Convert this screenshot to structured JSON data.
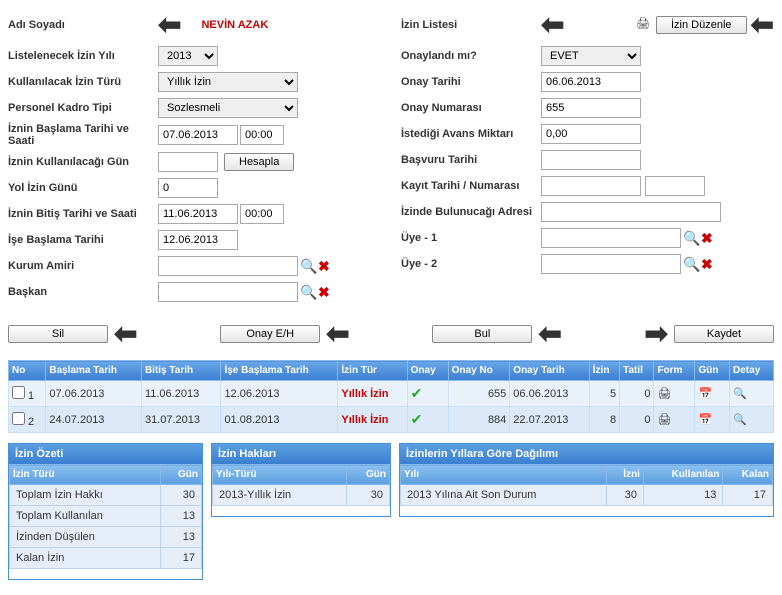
{
  "left": {
    "name_label": "Adı Soyadı",
    "name_value": "NEVİN AZAK",
    "year_label": "Listelenecek İzin Yılı",
    "year_value": "2013",
    "type_label": "Kullanılacak İzin Türü",
    "type_value": "Yıllık İzin",
    "kadro_label": "Personel Kadro Tipi",
    "kadro_value": "Sozlesmeli",
    "start_label": "İznin Başlama Tarihi ve Saati",
    "start_date": "07.06.2013",
    "start_time": "00:00",
    "days_label": "İznin Kullanılacağı Gün",
    "calc_btn": "Hesapla",
    "road_label": "Yol İzin Günü",
    "road_value": "0",
    "end_label": "İznin Bitiş Tarihi ve Saati",
    "end_date": "11.06.2013",
    "end_time": "00:00",
    "work_label": "İşe Başlama Tarihi",
    "work_date": "12.06.2013",
    "amir_label": "Kurum Amiri",
    "baskan_label": "Başkan"
  },
  "right": {
    "list_label": "İzin Listesi",
    "edit_btn": "İzin Düzenle",
    "approved_label": "Onaylandı mı?",
    "approved_value": "EVET",
    "approve_date_label": "Onay Tarihi",
    "approve_date": "06.06.2013",
    "approve_no_label": "Onay Numarası",
    "approve_no": "655",
    "avans_label": "İstediği Avans Miktarı",
    "avans_value": "0,00",
    "basvuru_label": "Başvuru Tarihi",
    "kayit_label": "Kayıt Tarihi / Numarası",
    "adres_label": "İzinde Bulunucağı Adresi",
    "uye1_label": "Üye - 1",
    "uye2_label": "Üye - 2"
  },
  "buttons": {
    "sil": "Sil",
    "onay": "Onay E/H",
    "bul": "Bul",
    "kaydet": "Kaydet"
  },
  "grid": {
    "headers": {
      "no": "No",
      "start": "Başlama Tarih",
      "end": "Bitiş Tarih",
      "work": "İşe Başlama Tarih",
      "type": "İzin Tür",
      "onay": "Onay",
      "onayno": "Onay No",
      "onaytarih": "Onay Tarih",
      "izin": "İzin",
      "tatil": "Tatil",
      "form": "Form",
      "gun": "Gün",
      "detay": "Detay"
    },
    "rows": [
      {
        "no": "1",
        "start": "07.06.2013",
        "end": "11.06.2013",
        "work": "12.06.2013",
        "type": "Yıllık İzin",
        "onay": "✔",
        "onayno": "655",
        "onaytarih": "06.06.2013",
        "izin": "5",
        "tatil": "0"
      },
      {
        "no": "2",
        "start": "24.07.2013",
        "end": "31.07.2013",
        "work": "01.08.2013",
        "type": "Yıllık İzin",
        "onay": "✔",
        "onayno": "884",
        "onaytarih": "22.07.2013",
        "izin": "8",
        "tatil": "0"
      }
    ]
  },
  "panels": {
    "ozet_title": "İzin Özeti",
    "ozet_h1": "İzin Türü",
    "ozet_h2": "Gün",
    "ozet_rows": [
      {
        "k": "Toplam İzin Hakkı",
        "v": "30"
      },
      {
        "k": "Toplam Kullanılan",
        "v": "13"
      },
      {
        "k": "İzinden Düşülen",
        "v": "13"
      },
      {
        "k": "Kalan İzin",
        "v": "17"
      }
    ],
    "haklar_title": "İzin Hakları",
    "haklar_h1": "Yılı-Türü",
    "haklar_h2": "Gün",
    "haklar_rows": [
      {
        "k": "2013-Yıllık İzin",
        "v": "30"
      }
    ],
    "dagilim_title": "İzinlerin Yıllara Göre Dağılımı",
    "dag_h1": "Yılı",
    "dag_h2": "İzni",
    "dag_h3": "Kullanılan",
    "dag_h4": "Kalan",
    "dag_rows": [
      {
        "y": "2013 Yılına Ait Son Durum",
        "i": "30",
        "k": "13",
        "r": "17"
      }
    ]
  }
}
